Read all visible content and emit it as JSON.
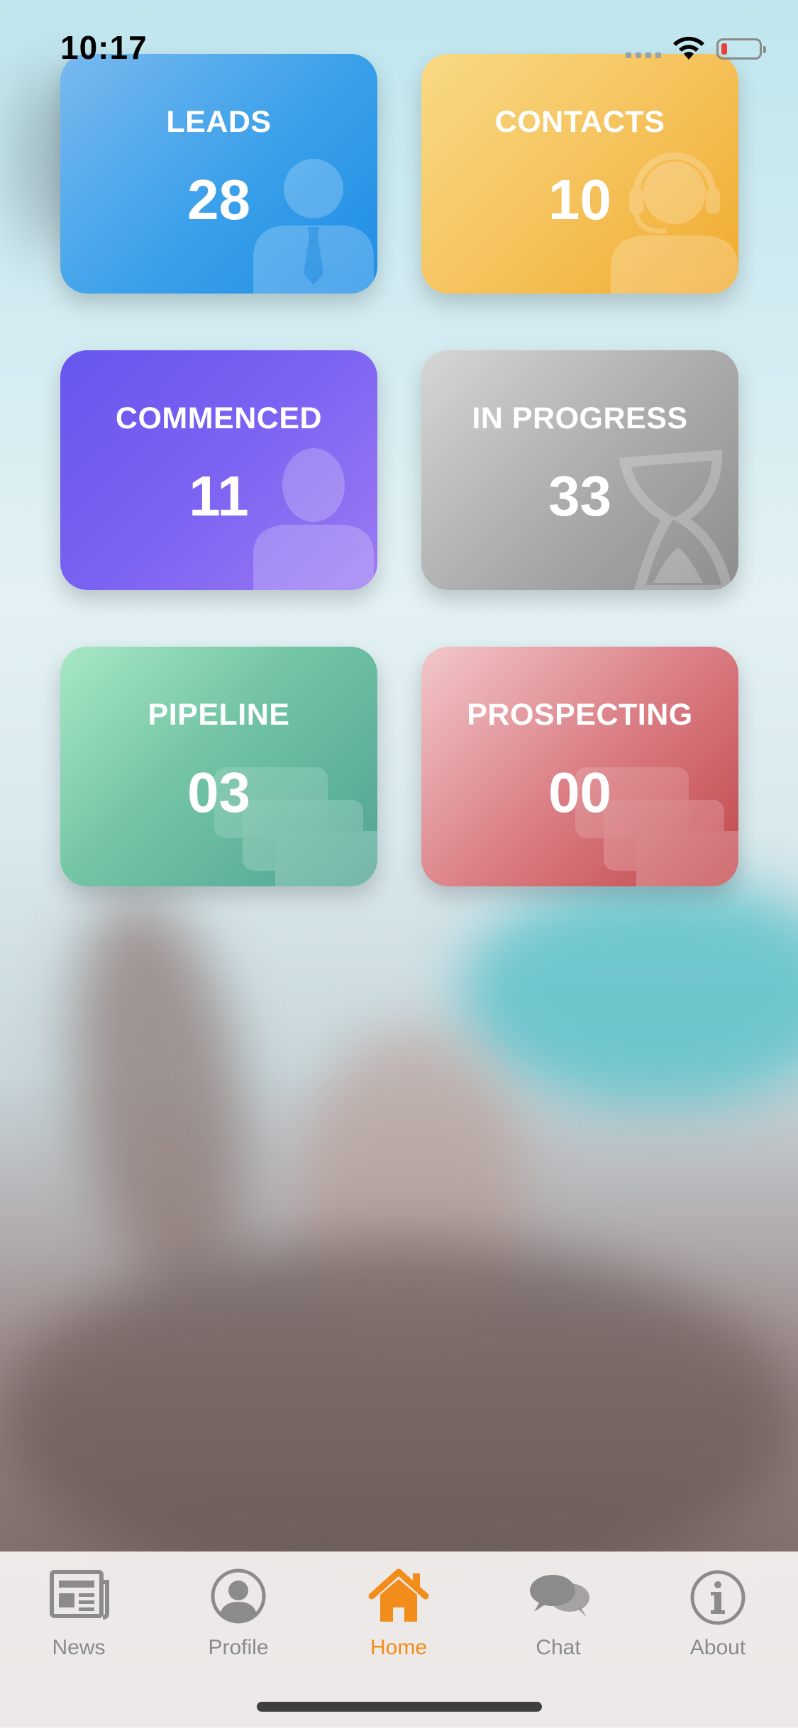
{
  "status_bar": {
    "time": "10:17",
    "icons": [
      "signal-dots-icon",
      "wifi-icon",
      "battery-low-icon"
    ],
    "battery_color": "#e8423a"
  },
  "dashboard": {
    "cards": [
      {
        "id": "leads",
        "title": "LEADS",
        "count": "28",
        "icon": "businessman-icon",
        "color": "#3aa0ea"
      },
      {
        "id": "contacts",
        "title": "CONTACTS",
        "count": "10",
        "icon": "headset-agent-icon",
        "color": "#f5c35d"
      },
      {
        "id": "commenced",
        "title": "COMMENCED",
        "count": "11",
        "icon": "person-icon",
        "color": "#7c63f2"
      },
      {
        "id": "in_progress",
        "title": "IN PROGRESS",
        "count": "33",
        "icon": "hourglass-icon",
        "color": "#aeaeae"
      },
      {
        "id": "pipeline",
        "title": "PIPELINE",
        "count": "03",
        "icon": "stacked-cards-icon",
        "color": "#72c4a4"
      },
      {
        "id": "prospecting",
        "title": "PROSPECTING",
        "count": "00",
        "icon": "stacked-cards-icon",
        "color": "#db8086"
      }
    ]
  },
  "tab_bar": {
    "active": "Home",
    "active_color": "#f28c1a",
    "inactive_color": "#8b8b8b",
    "tabs": [
      {
        "label": "News",
        "icon": "newspaper-icon"
      },
      {
        "label": "Profile",
        "icon": "profile-icon"
      },
      {
        "label": "Home",
        "icon": "home-icon"
      },
      {
        "label": "Chat",
        "icon": "chat-bubbles-icon"
      },
      {
        "label": "About",
        "icon": "info-icon"
      }
    ]
  }
}
